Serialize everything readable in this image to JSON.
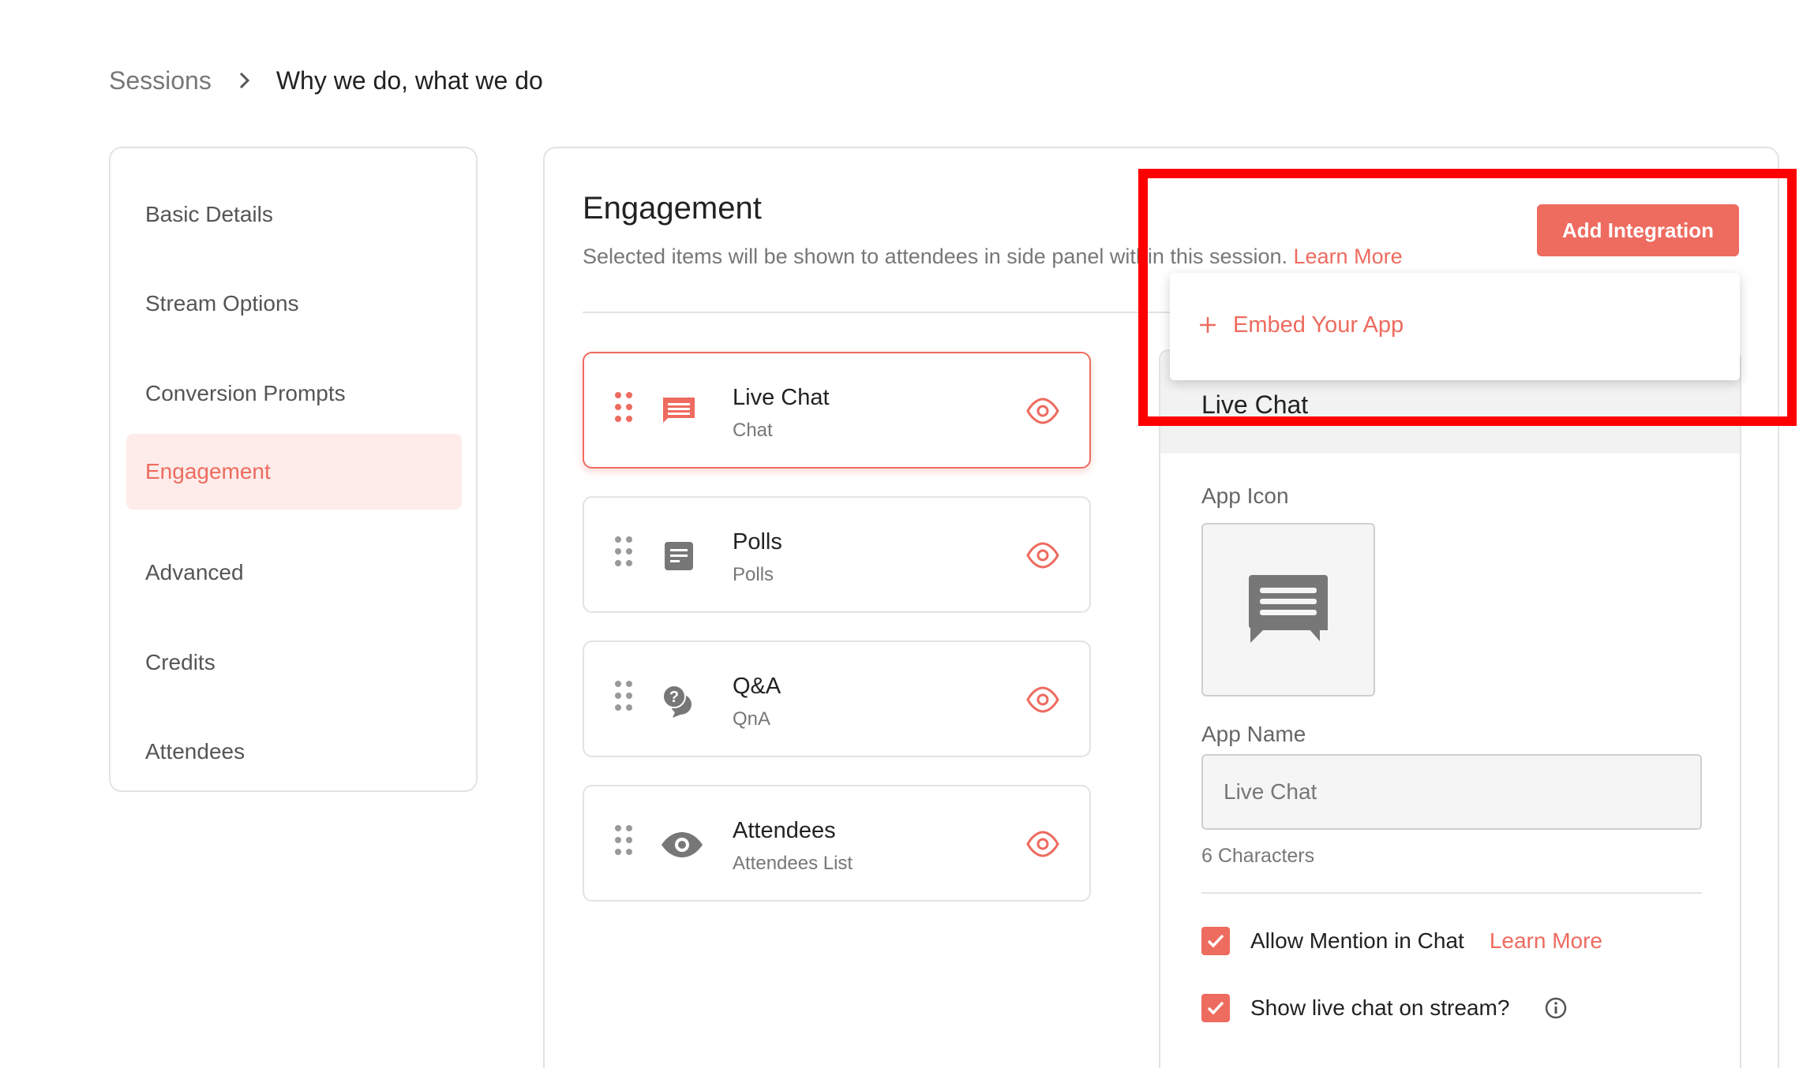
{
  "breadcrumb": {
    "root": "Sessions",
    "current": "Why we do, what we do"
  },
  "nav": {
    "items": [
      {
        "label": "Basic Details",
        "active": false
      },
      {
        "label": "Stream Options",
        "active": false
      },
      {
        "label": "Conversion Prompts",
        "active": false
      },
      {
        "label": "Engagement",
        "active": true
      },
      {
        "label": "Advanced",
        "active": false
      },
      {
        "label": "Credits",
        "active": false
      },
      {
        "label": "Attendees",
        "active": false
      }
    ]
  },
  "engagement": {
    "title": "Engagement",
    "subtitle": "Selected items will be shown to attendees in side panel within this session.",
    "learn_more": "Learn More",
    "add_integration": "Add Integration",
    "dropdown_item": "Embed Your App",
    "cards": [
      {
        "title": "Live Chat",
        "subtitle": "Chat",
        "icon": "chat-icon",
        "selected": true
      },
      {
        "title": "Polls",
        "subtitle": "Polls",
        "icon": "poll-icon",
        "selected": false
      },
      {
        "title": "Q&A",
        "subtitle": "QnA",
        "icon": "question-answer-icon",
        "selected": false
      },
      {
        "title": "Attendees",
        "subtitle": "Attendees List",
        "icon": "eye-icon",
        "selected": false
      }
    ]
  },
  "detail": {
    "title": "Live Chat",
    "app_icon_label": "App Icon",
    "app_icon": "chat-icon",
    "app_name_label": "App Name",
    "app_name_value": "Live Chat",
    "char_count": "6 Characters",
    "allow_mention_label": "Allow Mention in Chat",
    "allow_mention_checked": true,
    "allow_mention_link": "Learn More",
    "show_on_stream_label": "Show live chat on stream?",
    "show_on_stream_checked": true
  },
  "colors": {
    "accent": "#ee6b5f",
    "accent_soft": "#fdecea",
    "highlight": "#ff0000",
    "icon_gray": "#777777"
  }
}
